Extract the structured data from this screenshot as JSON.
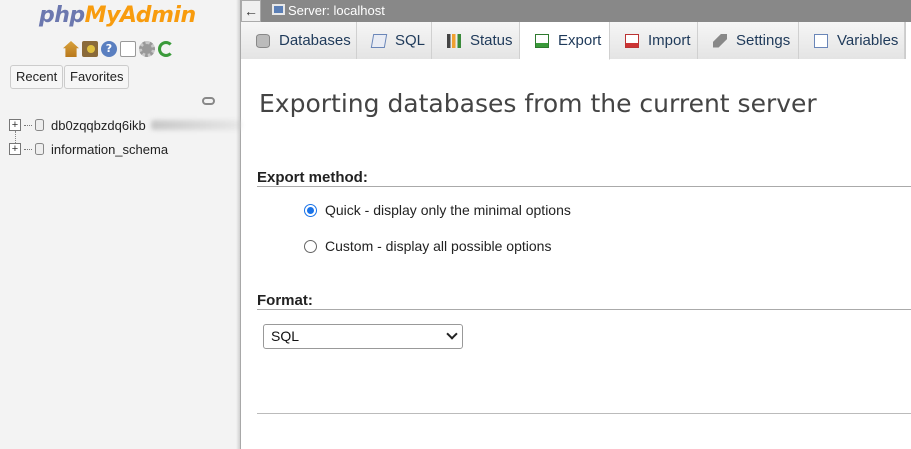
{
  "app": {
    "logo_php": "php",
    "logo_myadmin": "MyAdmin",
    "brand_colors": {
      "php": "#6c78af",
      "myadmin": "#f89c0e"
    }
  },
  "nav": {
    "icons": [
      "home-icon",
      "logout-icon",
      "help-icon",
      "documentation-icon",
      "settings-gear-icon",
      "reload-icon"
    ],
    "recent_label": "Recent",
    "favorites_label": "Favorites",
    "databases": [
      {
        "name": "db0zqqbzdq6ikb",
        "name_partially_obscured": true
      },
      {
        "name": "information_schema"
      }
    ]
  },
  "server_bar": {
    "back_glyph": "←",
    "label": "Server: localhost"
  },
  "tabs": [
    {
      "label": "Databases",
      "icon": "database-icon"
    },
    {
      "label": "SQL",
      "icon": "sql-icon"
    },
    {
      "label": "Status",
      "icon": "status-icon"
    },
    {
      "label": "Export",
      "icon": "export-icon",
      "active": true
    },
    {
      "label": "Import",
      "icon": "import-icon"
    },
    {
      "label": "Settings",
      "icon": "wrench-icon"
    },
    {
      "label": "Variables",
      "icon": "variables-icon"
    }
  ],
  "main": {
    "title": "Exporting databases from the current server",
    "export_method": {
      "heading": "Export method:",
      "options": [
        {
          "label": "Quick - display only the minimal options",
          "selected": true
        },
        {
          "label": "Custom - display all possible options",
          "selected": false
        }
      ]
    },
    "format": {
      "heading": "Format:",
      "selected": "SQL"
    }
  },
  "colors": {
    "accent": "#1a73e8",
    "server_bar": "#888888"
  }
}
